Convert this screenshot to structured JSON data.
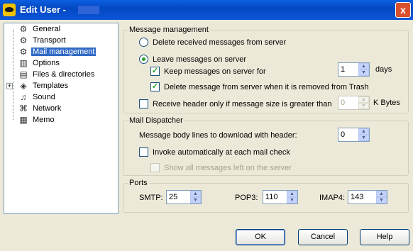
{
  "window": {
    "title": "Edit User -",
    "close_label": "x"
  },
  "tree": {
    "items": [
      {
        "label": "General",
        "icon": "sliders-icon"
      },
      {
        "label": "Transport",
        "icon": "gear-icon"
      },
      {
        "label": "Mail management",
        "icon": "gear-icon",
        "selected": true
      },
      {
        "label": "Options",
        "icon": "options-icon"
      },
      {
        "label": "Files & directories",
        "icon": "files-icon"
      },
      {
        "label": "Templates",
        "icon": "templates-icon"
      },
      {
        "label": "Sound",
        "icon": "music-note-icon"
      },
      {
        "label": "Network",
        "icon": "network-icon"
      },
      {
        "label": "Memo",
        "icon": "memo-icon"
      }
    ]
  },
  "message_management": {
    "legend": "Message management",
    "delete_label": "Delete received messages from server",
    "leave_label": "Leave messages on server",
    "keep_label": "Keep messages on server for",
    "keep_value": "1",
    "days_label": "days",
    "delete_trash_label": "Delete message from server when it is removed from Trash",
    "receive_header_label": "Receive header only if message size is greater than",
    "kbytes_value": "0",
    "kbytes_label": "K Bytes"
  },
  "mail_dispatcher": {
    "legend": "Mail Dispatcher",
    "body_lines_label": "Message body lines to download with header:",
    "body_lines_value": "0",
    "invoke_label": "Invoke automatically at each mail check",
    "show_all_label": "Show all messages left on the server"
  },
  "ports": {
    "legend": "Ports",
    "smtp_label": "SMTP:",
    "smtp_value": "25",
    "pop3_label": "POP3:",
    "pop3_value": "110",
    "imap4_label": "IMAP4:",
    "imap4_value": "143"
  },
  "buttons": {
    "ok": "OK",
    "cancel": "Cancel",
    "help": "Help"
  }
}
